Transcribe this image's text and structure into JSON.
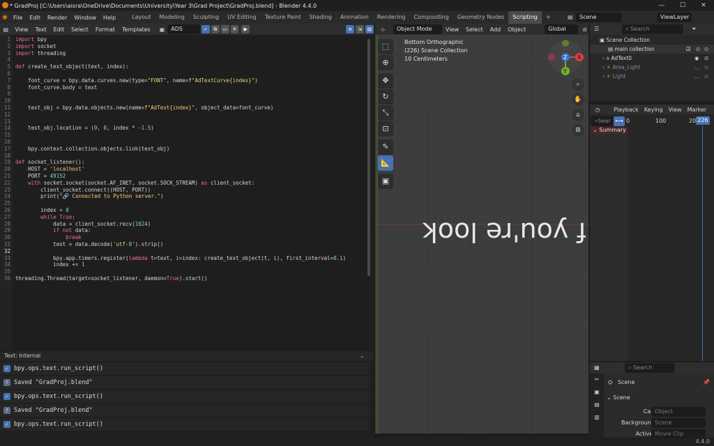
{
  "window": {
    "title": "* GradProj [C:\\Users\\aisra\\OneDrive\\Documents\\University\\Year 3\\Grad Project\\GradProj.blend] - Blender 4.4.0"
  },
  "menus": [
    "File",
    "Edit",
    "Render",
    "Window",
    "Help"
  ],
  "workspaces": [
    "Layout",
    "Modeling",
    "Sculpting",
    "UV Editing",
    "Texture Paint",
    "Shading",
    "Animation",
    "Rendering",
    "Compositing",
    "Geometry Nodes",
    "Scripting"
  ],
  "active_workspace": "Scripting",
  "scene": {
    "name": "Scene",
    "view_layer": "ViewLayer"
  },
  "text_editor": {
    "menus": [
      "View",
      "Text",
      "Edit",
      "Select",
      "Format",
      "Templates"
    ],
    "file_name": "ADS",
    "footer": "Text: Internal",
    "lines": [
      "import bpy",
      "import socket",
      "import threading",
      "",
      "def create_text_object(text, index):",
      "",
      "    font_curve = bpy.data.curves.new(type=\"FONT\", name=f\"AdTextCurve{index}\")",
      "    font_curve.body = text",
      "",
      "",
      "    text_obj = bpy.data.objects.new(name=f\"AdText{index}\", object_data=font_curve)",
      "",
      "",
      "    text_obj.location = (0, 0, index * -1.5)",
      "",
      "",
      "    bpy.context.collection.objects.link(text_obj)",
      "",
      "def socket_listener():",
      "    HOST = 'localhost'",
      "    PORT = 49152",
      "    with socket.socket(socket.AF_INET, socket.SOCK_STREAM) as client_socket:",
      "        client_socket.connect((HOST, PORT))",
      "        print(\"🔗 Connected to Python server.\")",
      "",
      "        index = 0",
      "        while True:",
      "            data = client_socket.recv(1024)",
      "            if not data:",
      "                break",
      "            text = data.decode('utf-8').strip()",
      "",
      "            bpy.app.timers.register(lambda t=text, i=index: create_text_object(t, i), first_interval=0.1)",
      "            index += 1",
      "",
      "threading.Thread(target=socket_listener, daemon=True).start()"
    ]
  },
  "info_log": [
    {
      "text": "bpy.ops.text.run_script()",
      "kind": "op"
    },
    {
      "text": "Saved \"GradProj.blend\"",
      "kind": "info"
    },
    {
      "text": "bpy.ops.text.run_script()",
      "kind": "op"
    },
    {
      "text": "Saved \"GradProj.blend\"",
      "kind": "info"
    },
    {
      "text": "bpy.ops.text.run_script()",
      "kind": "op"
    }
  ],
  "viewport": {
    "menus": [
      "View",
      "Select",
      "Add",
      "Object"
    ],
    "mode": "Object Mode",
    "orientation": "Global",
    "overlay_lines": [
      "Bottom Orthographic",
      "(226) Scene Collection",
      "10 Centimeters"
    ],
    "mirrored_text": "If you're look",
    "gizmo": {
      "x": "X",
      "y": "Y",
      "z": "Z"
    }
  },
  "outliner": {
    "search_placeholder": "Search",
    "items": [
      {
        "label": "Scene Collection",
        "color": "#dcdcdc"
      },
      {
        "label": "main collection",
        "color": "#dcdcdc"
      },
      {
        "label": "AdText0",
        "color": "#dcdcdc"
      },
      {
        "label": "Area_Light",
        "color": "#8a8a8a"
      },
      {
        "label": "Light",
        "color": "#8a8a8a"
      }
    ]
  },
  "dopesheet": {
    "menus": [
      "Playback",
      "Keying",
      "View",
      "Marker"
    ],
    "search_placeholder": "Sear",
    "frames": [
      "0",
      "100",
      "20"
    ],
    "current_frame": "226",
    "summary": "Summary"
  },
  "properties": {
    "search_placeholder": "Search",
    "breadcrumb": "Scene",
    "panel": "Scene",
    "fields": [
      {
        "label": "Camera",
        "placeholder": "Object"
      },
      {
        "label": "Background S...",
        "placeholder": "Scene"
      },
      {
        "label": "Active Clip",
        "placeholder": "Movie Clip"
      }
    ]
  },
  "status": {
    "version": "4.4.0"
  },
  "colors": {
    "accent": "#4772b3",
    "keyword": "#ec6e9a",
    "string": "#f0d27a",
    "active_item": "#e8a23a"
  }
}
